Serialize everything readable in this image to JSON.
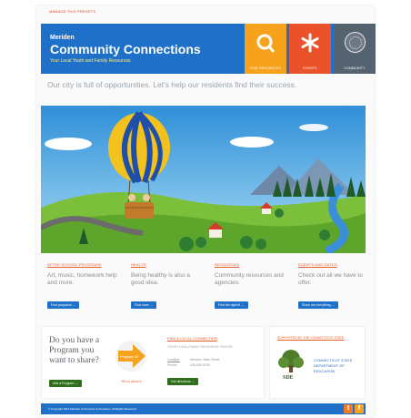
{
  "top_link": "MANAGE THIS PRESETS",
  "header": {
    "brand_small": "Meriden",
    "brand_title": "Community Connections",
    "brand_sub": "Your Local Youth and Family Resources",
    "tiles": [
      {
        "label": "FIND RESOURCES",
        "icon": "magnifier-icon",
        "color": "#f6a21c"
      },
      {
        "label": "EVENTS",
        "icon": "asterisk-icon",
        "color": "#e9522b"
      },
      {
        "label": "COMMUNITY",
        "icon": "city-seal-icon",
        "color": "#556270"
      }
    ]
  },
  "tagline": "Our city is full of opportunities. Let's help our residents find their success.",
  "columns": [
    {
      "heading": "AFTER SCHOOL PROGRAMS",
      "text": "Art, music, homework help and more.",
      "button": "Find programs →"
    },
    {
      "heading": "HEALTH",
      "text": "Being healthy is also a good idea.",
      "button": "Find more →"
    },
    {
      "heading": "RESOURCES",
      "text": "Community resources and agencies.",
      "button": "Find the right fit →"
    },
    {
      "heading": "EVENTS AND DATES",
      "text": "Check out all we have to offer.",
      "button": "Show me everything →"
    }
  ],
  "submit": {
    "question": "Do you have a Program you want to share?",
    "button": "Add a Program →",
    "arrow_label": "Program ID",
    "arrow_sub": "Tell us about it"
  },
  "find": {
    "heading": "FIND A LOCAL CONNECTION",
    "sub": "YOUR LOCAL FAMILY RESOURCE CENTER",
    "k1": "Location:",
    "v1": "Meriden, Main Street",
    "k2": "Phone:",
    "v2": "203-630-4200",
    "button": "Get directions →"
  },
  "sde": {
    "heading": "SUPPORTED BY THE CONNECTICUT STATE",
    "logo_text": "SDE",
    "org": "CONNECTICUT STATE DEPARTMENT OF EDUCATION"
  },
  "footer": {
    "copyright": "© Copyright 2014 Meriden Community Connections. All Rights Reserved.",
    "twitter": "t",
    "facebook": "f"
  },
  "colors": {
    "blue": "#1f70c9",
    "orange": "#f6a21c",
    "red": "#e9522b",
    "slate": "#556270",
    "green": "#2f6e1d"
  }
}
